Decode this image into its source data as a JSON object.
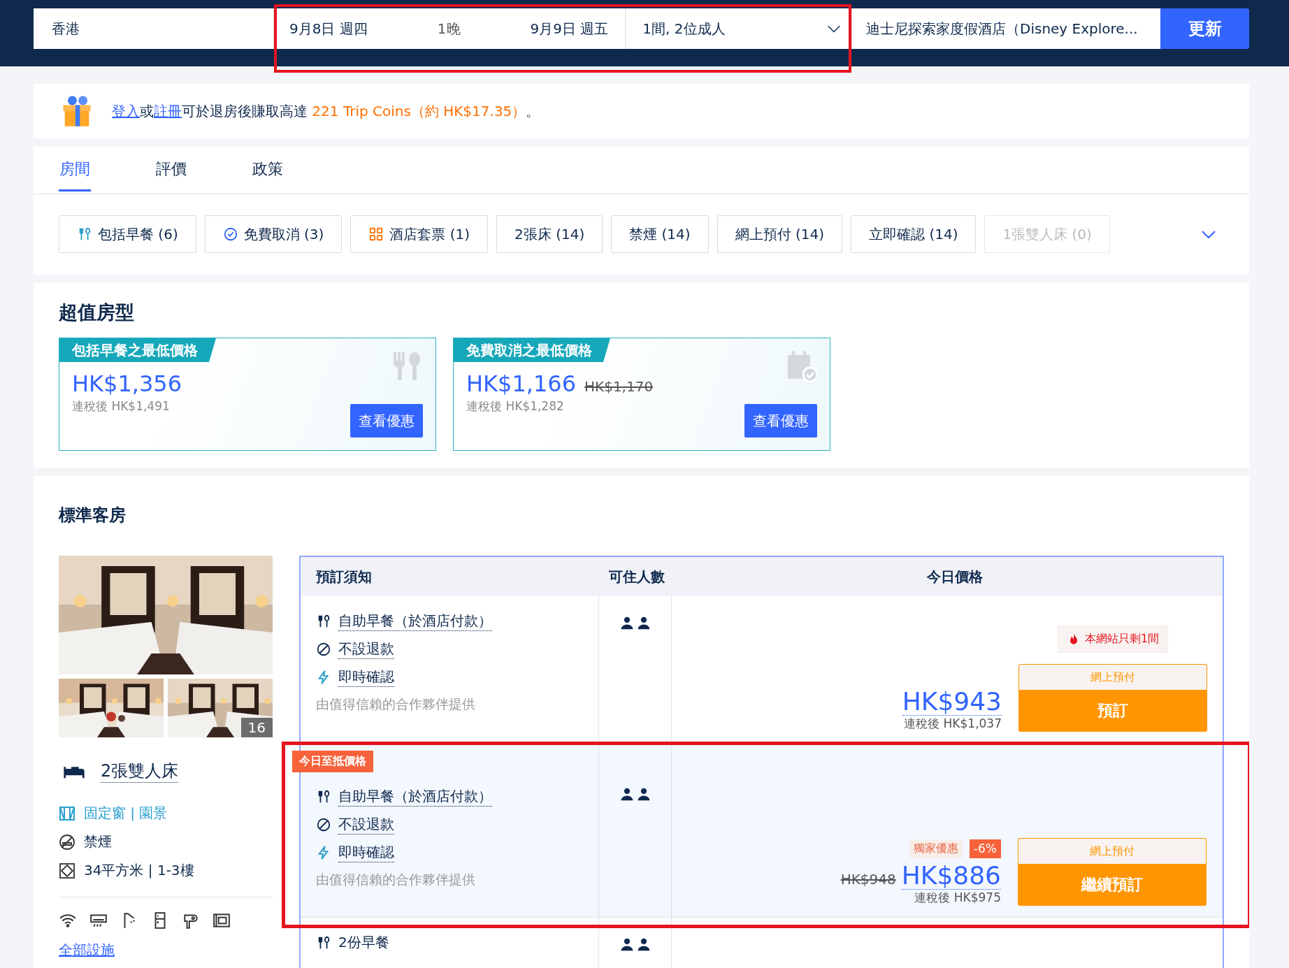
{
  "search": {
    "destination": "香港",
    "checkin": "9月8日 週四",
    "nights": "1晚",
    "checkout": "9月9日 週五",
    "guests": "1間, 2位成人",
    "hotel": "迪士尼探索家度假酒店（Disney Explore...",
    "button": "更新",
    "highlighted": true
  },
  "banner": {
    "parts": [
      {
        "kind": "link",
        "text": "登入"
      },
      {
        "kind": "plain",
        "text": "或"
      },
      {
        "kind": "link",
        "text": "註冊"
      },
      {
        "kind": "plain",
        "text": "可於退房後賺取高達 "
      },
      {
        "kind": "accent",
        "text": "221 Trip Coins（約 HK$17.35）"
      },
      {
        "kind": "plain",
        "text": "。"
      }
    ]
  },
  "tabs": [
    {
      "label": "房間",
      "selected": true
    },
    {
      "label": "評價",
      "selected": false
    },
    {
      "label": "政策",
      "selected": false
    }
  ],
  "filters": [
    {
      "label": "包括早餐 (6)",
      "kind": "breakfast",
      "disabled": false
    },
    {
      "label": "免費取消 (3)",
      "kind": "check",
      "disabled": false
    },
    {
      "label": "酒店套票 (1)",
      "kind": "package",
      "disabled": false
    },
    {
      "label": "2張床 (14)",
      "kind": "plain",
      "disabled": false
    },
    {
      "label": "禁煙 (14)",
      "kind": "plain",
      "disabled": false
    },
    {
      "label": "網上預付 (14)",
      "kind": "plain",
      "disabled": false
    },
    {
      "label": "立即確認 (14)",
      "kind": "plain",
      "disabled": false
    },
    {
      "label": "1張雙人床 (0)",
      "kind": "plain",
      "disabled": true
    }
  ],
  "deals": {
    "title": "超值房型",
    "cards": [
      {
        "tag": "包括早餐之最低價格",
        "kind": "breakfast",
        "price": "HK$1,356",
        "after_tax": "連稅後 HK$1,491",
        "button": "查看優惠"
      },
      {
        "tag": "免費取消之最低價格",
        "kind": "cancel",
        "price": "HK$1,166",
        "old_price": "HK$1,170",
        "after_tax": "連稅後 HK$1,282",
        "button": "查看優惠"
      }
    ]
  },
  "room": {
    "title": "標準客房",
    "photo_count": "16",
    "bed": "2張雙人床",
    "features": [
      {
        "kind": "window",
        "text": "固定窗 | 園景"
      },
      {
        "kind": "no-smoking",
        "text": "禁煙"
      },
      {
        "kind": "area",
        "text": "34平方米 | 1-3樓"
      }
    ],
    "amenities_link": "全部設施",
    "table": {
      "columns": [
        "預訂須知",
        "可住人數",
        "今日價格"
      ],
      "rows": [
        {
          "highlighted": false,
          "terms": [
            {
              "kind": "breakfast",
              "text": "自助早餐（於酒店付款）"
            },
            {
              "kind": "no-refund",
              "text": "不設退款"
            },
            {
              "kind": "instant",
              "text": "即時確認"
            }
          ],
          "provider": "由值得信賴的合作夥伴提供",
          "urgency": "本網站只剩1間",
          "price": "HK$943",
          "after_tax": "連稅後 HK$1,037",
          "pay_label": "網上預付",
          "button": "預訂"
        },
        {
          "highlighted": true,
          "tag": "今日至抵價格",
          "terms": [
            {
              "kind": "breakfast",
              "text": "自助早餐（於酒店付款）"
            },
            {
              "kind": "no-refund",
              "text": "不設退款"
            },
            {
              "kind": "instant",
              "text": "即時確認"
            }
          ],
          "provider": "由值得信賴的合作夥伴提供",
          "promo": "獨家優惠",
          "discount": "-6%",
          "old_price": "HK$948",
          "price": "HK$886",
          "after_tax": "連稅後 HK$975",
          "pay_label": "網上預付",
          "button": "繼續預訂"
        },
        {
          "highlighted": false,
          "terms": [
            {
              "kind": "breakfast-plain",
              "text": "2份早餐"
            }
          ]
        }
      ]
    }
  }
}
